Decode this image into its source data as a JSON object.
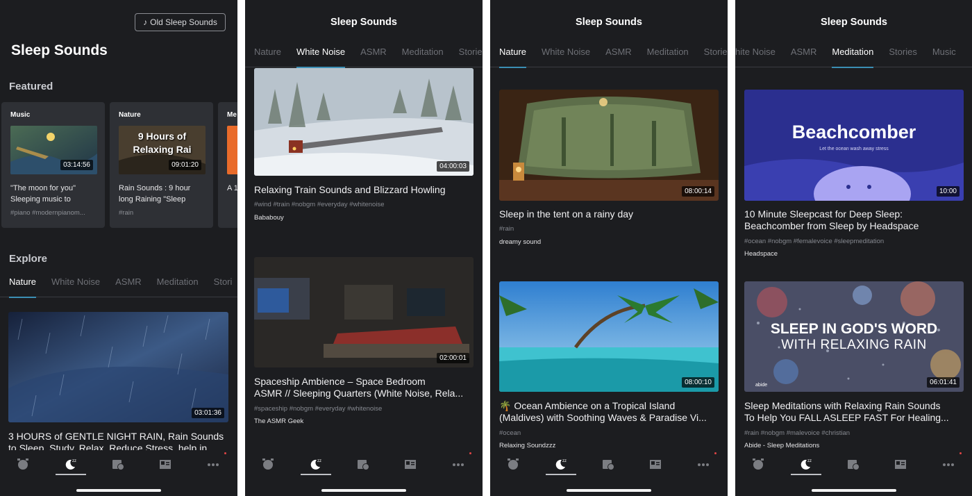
{
  "screen1": {
    "old_btn_label": "Old Sleep Sounds",
    "title": "Sleep Sounds",
    "featured_label": "Featured",
    "featured": [
      {
        "category": "Music",
        "title": "\"The moon for you\" Sleeping music to",
        "tags": "#piano #modernpianom...",
        "duration": "03:14:56"
      },
      {
        "category": "Nature",
        "title": "Rain Sounds : 9 hour long Raining \"Sleep",
        "tags": "#rain",
        "duration": "09:01:20",
        "thumb_text": "9 Hours of Relaxing Rai"
      },
      {
        "category": "Me",
        "title": "A 1 Me",
        "tags": "",
        "duration": ""
      }
    ],
    "explore_label": "Explore",
    "tabs": [
      "Nature",
      "White Noise",
      "ASMR",
      "Meditation",
      "Stori"
    ],
    "video": {
      "title_1": "3 HOURS of GENTLE NIGHT RAIN, Rain Sounds",
      "title_2": "to Sleep, Study, Relax, Reduce Stress, help in",
      "duration": "03:01:36"
    }
  },
  "screen2": {
    "title": "Sleep Sounds",
    "tabs": [
      "Nature",
      "White Noise",
      "ASMR",
      "Meditation",
      "Storie"
    ],
    "videos": [
      {
        "title_1": "Relaxing Train Sounds and Blizzard Howling",
        "title_2": "",
        "tags": "#wind #train #nobgm #everyday #whitenoise",
        "channel": "Bababouy",
        "duration": "04:00:03"
      },
      {
        "title_1": "Spaceship Ambience – Space Bedroom",
        "title_2": "ASMR // Sleeping Quarters (White Noise, Rela...",
        "tags": "#spaceship #nobgm #everyday #whitenoise",
        "channel": "The ASMR Geek",
        "duration": "02:00:01"
      }
    ]
  },
  "screen3": {
    "title": "Sleep Sounds",
    "tabs": [
      "Nature",
      "White Noise",
      "ASMR",
      "Meditation",
      "Storie"
    ],
    "videos": [
      {
        "title_1": "Sleep in the tent on a rainy day",
        "title_2": "",
        "tags": "#rain",
        "channel": "dreamy sound",
        "duration": "08:00:14"
      },
      {
        "title_1": "🌴 Ocean Ambience on a Tropical Island",
        "title_2": "(Maldives) with Soothing Waves & Paradise Vi...",
        "tags": "#ocean",
        "channel": "Relaxing Soundzzz",
        "duration": "08:00:10"
      }
    ]
  },
  "screen4": {
    "title": "Sleep Sounds",
    "tabs": [
      "hite Noise",
      "ASMR",
      "Meditation",
      "Stories",
      "Music"
    ],
    "videos": [
      {
        "title_1": "10 Minute Sleepcast for Deep Sleep:",
        "title_2": "Beachcomber from Sleep by Headspace",
        "tags": "#ocean #nobgm #femalevoice #sleepmeditation",
        "channel": "Headspace",
        "duration": "10:00",
        "thumb_title": "Beachcomber",
        "thumb_sub": "Let the ocean wash away stress"
      },
      {
        "title_1": "Sleep Meditations with Relaxing Rain Sounds",
        "title_2": "To Help You FALL ASLEEP FAST For Healing...",
        "tags": "#rain #nobgm #malevoice #christian",
        "channel": "Abide - Sleep Meditations",
        "duration": "06:01:41",
        "thumb_line1": "SLEEP IN GOD'S WORD",
        "thumb_line2": "WITH RELAXING RAIN",
        "thumb_logo": "abide"
      }
    ]
  },
  "nav_icons": [
    "alarm-icon",
    "sleep-moon-icon",
    "calendar-clock-icon",
    "news-icon",
    "more-icon"
  ],
  "colors": {
    "background": "#1c1d20",
    "card": "#2e3035",
    "tab_underline": "#3b8fb5",
    "badge": "#e04545"
  }
}
